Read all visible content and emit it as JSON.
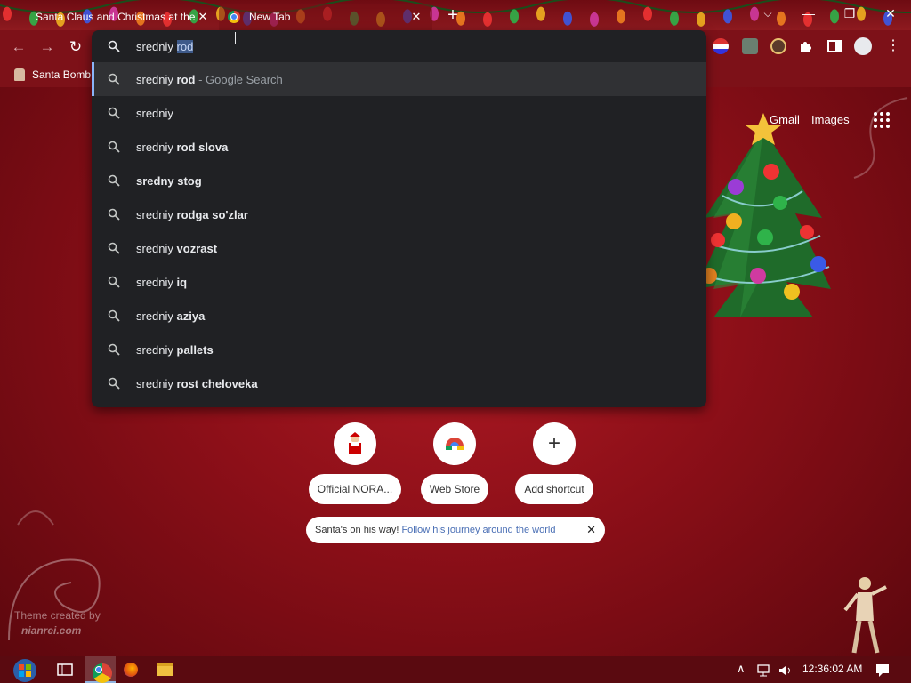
{
  "tabs": [
    {
      "label": "Santa Claus and Christmas at the",
      "close": "✕"
    },
    {
      "label": "New Tab",
      "close": "✕"
    }
  ],
  "window_controls": {
    "tab_search": "⌵",
    "minimize": "—",
    "restore": "❐",
    "close": "✕"
  },
  "new_tab_symbol": "+",
  "nav": {
    "back": "←",
    "forward": "→",
    "reload": "↻"
  },
  "bookmarks": [
    {
      "label": "Santa Bomb"
    }
  ],
  "omnibox": {
    "typed_prefix": "sredniy ",
    "typed_selected": "rod",
    "suggestions": [
      {
        "plain": "sredniy ",
        "bold": "rod",
        "suffix": " - Google Search",
        "selected": true
      },
      {
        "plain": "sredniy",
        "bold": "",
        "suffix": ""
      },
      {
        "plain": "sredniy ",
        "bold": "rod slova",
        "suffix": ""
      },
      {
        "plain": "",
        "bold": "sredny stog",
        "suffix": ""
      },
      {
        "plain": "sredniy ",
        "bold": "rodga so'zlar",
        "suffix": ""
      },
      {
        "plain": "sredniy ",
        "bold": "vozrast",
        "suffix": ""
      },
      {
        "plain": "sredniy ",
        "bold": "iq",
        "suffix": ""
      },
      {
        "plain": "sredniy ",
        "bold": "aziya",
        "suffix": ""
      },
      {
        "plain": "sredniy ",
        "bold": "pallets",
        "suffix": ""
      },
      {
        "plain": "sredniy ",
        "bold": "rost cheloveka",
        "suffix": ""
      }
    ]
  },
  "google_links": {
    "gmail": "Gmail",
    "images": "Images"
  },
  "shortcuts": [
    {
      "label": "Official NORA...",
      "icon": "santa-icon"
    },
    {
      "label": "Web Store",
      "icon": "web-store-icon"
    },
    {
      "label": "Add shortcut",
      "icon": "plus-icon",
      "symbol": "+"
    }
  ],
  "promo": {
    "text": "Santa's on his way!",
    "link": "Follow his journey around the world",
    "close": "✕"
  },
  "credit": {
    "line1": "Theme created by",
    "line2": "nianrei.com"
  },
  "taskbar": {
    "clock": "12:36:02 AM"
  },
  "colors": {
    "omnibox_bg": "#202124",
    "selected_row": "#303134",
    "accent": "#8ab4f8",
    "theme_red": "#8c0f18"
  }
}
